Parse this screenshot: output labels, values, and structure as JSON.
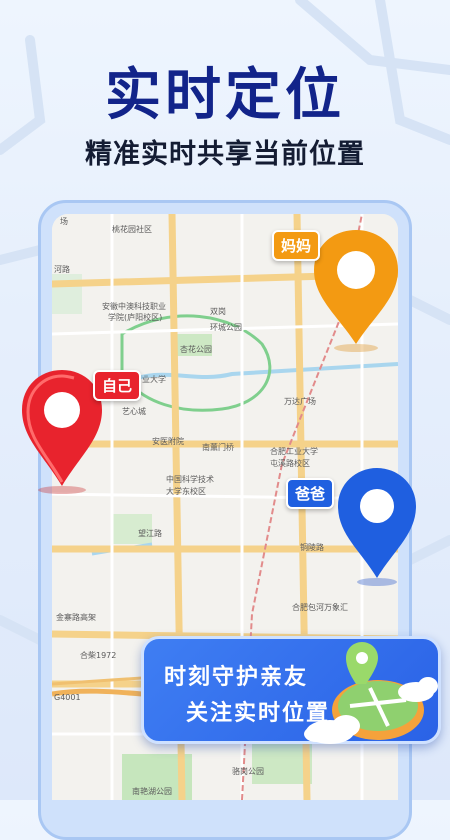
{
  "header": {
    "title": "实时定位",
    "subtitle": "精准实时共享当前位置"
  },
  "map": {
    "labels": [
      "桃花园社区",
      "河路",
      "安徽中澳科技职业",
      "学院(庐阳校区)",
      "双岗",
      "环城公园",
      "杏花公园",
      "业大学",
      "艺心城",
      "万达广场",
      "安医附院",
      "南薰门桥",
      "合肥工业大学",
      "屯溪路校区",
      "中国科学技术",
      "大学东校区",
      "望江路",
      "铜陵路",
      "金寨路高架",
      "合柴1972",
      "合肥包河万象汇",
      "骆岗公园",
      "南艳湖公园",
      "G4001",
      "场",
      "广场"
    ],
    "markers": {
      "self_label": "自己",
      "mom_label": "妈妈",
      "dad_label": "爸爸"
    }
  },
  "card": {
    "line1": "时刻守护亲友",
    "line2": "关注实时位置"
  },
  "colors": {
    "headline": "#12248a",
    "pin_self": "#e8232d",
    "pin_mom": "#f39a12",
    "pin_dad": "#1f5fe0",
    "card_bg": "#3371ee"
  }
}
